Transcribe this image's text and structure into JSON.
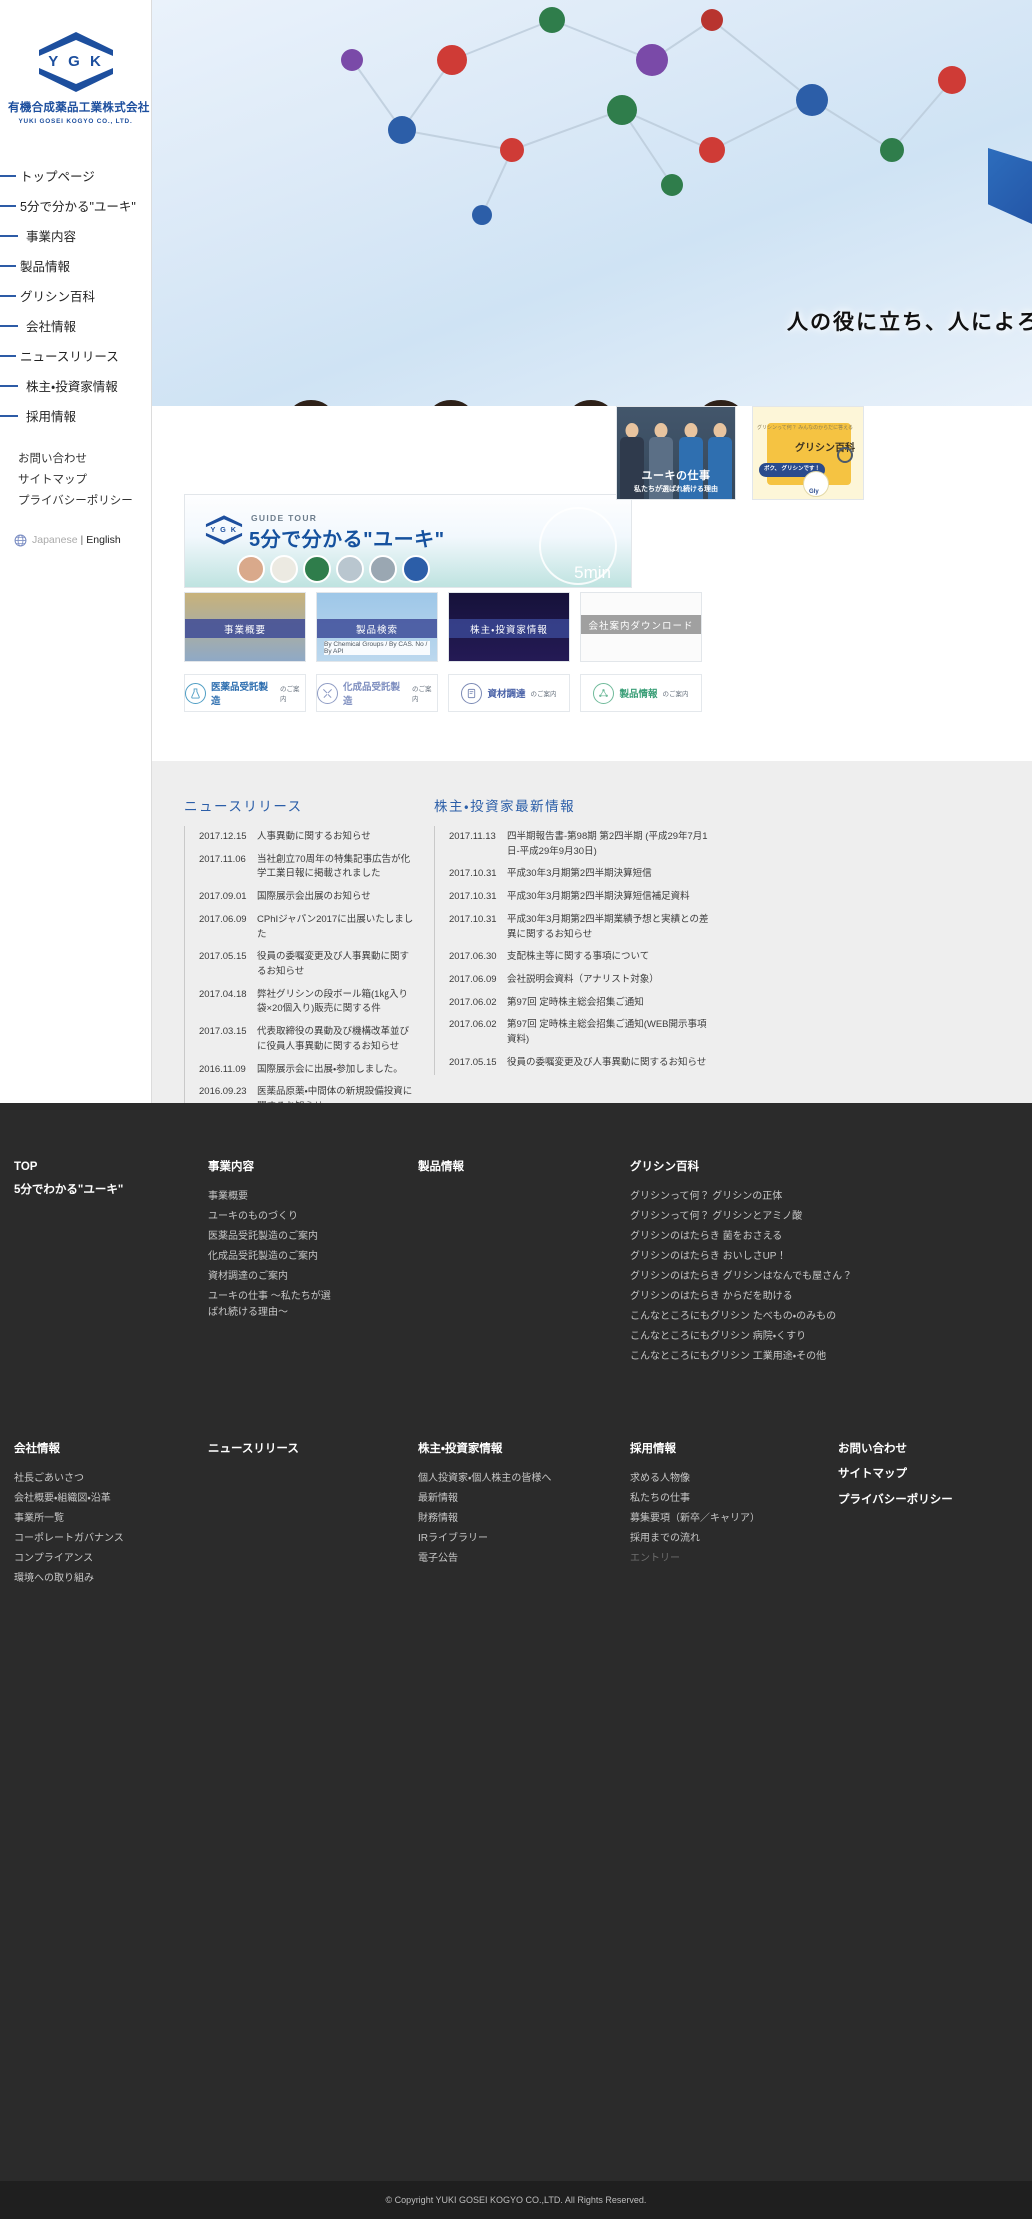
{
  "brand": {
    "logo_letters": "Y G K",
    "name_ja": "有機合成薬品工業株式会社",
    "name_en": "YUKI GOSEI KOGYO CO., LTD."
  },
  "sidebar": {
    "nav": [
      {
        "label": "トップページ"
      },
      {
        "label": "5分で分かる\"ユーキ\""
      },
      {
        "label": "事業内容"
      },
      {
        "label": "製品情報"
      },
      {
        "label": "グリシン百科"
      },
      {
        "label": "会社情報"
      },
      {
        "label": "ニュースリリース"
      },
      {
        "label": "株主・投資家情報"
      },
      {
        "label": "採用情報"
      }
    ],
    "sub": [
      {
        "label": "お問い合わせ"
      },
      {
        "label": "サイトマップ"
      },
      {
        "label": "プライバシーポリシー"
      }
    ],
    "lang": {
      "icon": "globe-icon",
      "japanese": "Japanese",
      "separator": "|",
      "english": "English"
    }
  },
  "hero": {
    "headline": "人の役に立ち、人によろ"
  },
  "banners": {
    "guide": {
      "kicker": "GUIDE TOUR",
      "title": "5分で分かる\"ユーキ\"",
      "timer": "5min",
      "logo_letters": "Y G K"
    },
    "work": {
      "title": "ユーキの仕事",
      "subtitle": "私たちが選ばれ続ける理由"
    },
    "glycine": {
      "kicker": "グリシンって何？\nみんなのからだに答える",
      "title": "グリシン百科",
      "bubble": "ボク、\nグリシンです！",
      "character": "Gly"
    },
    "tiles": [
      {
        "label": "事業概要",
        "sub": ""
      },
      {
        "label": "製品検索",
        "sub": "By Chemical Groups / By CAS. No / By API"
      },
      {
        "label": "株主・投資家情報",
        "sub": ""
      },
      {
        "label": "会社案内ダウンロード",
        "sub": ""
      }
    ],
    "links": [
      {
        "icon": "flask-icon",
        "title": "医薬品受託製造",
        "suffix": "のご案内"
      },
      {
        "icon": "tools-icon",
        "title": "化成品受託製造",
        "suffix": "のご案内"
      },
      {
        "icon": "clipboard-icon",
        "title": "資材調達",
        "suffix": "のご案内"
      },
      {
        "icon": "molecule-icon",
        "title": "製品情報",
        "suffix": "のご案内"
      }
    ]
  },
  "news": {
    "left_title": "ニュースリリース",
    "left_items": [
      {
        "date": "2017.12.15",
        "text": "人事異動に関するお知らせ"
      },
      {
        "date": "2017.11.06",
        "text": "当社創立70周年の特集記事広告が化学工業日報に掲載されました"
      },
      {
        "date": "2017.09.01",
        "text": "国際展示会出展のお知らせ"
      },
      {
        "date": "2017.06.09",
        "text": "CPhIジャパン2017に出展いたしました"
      },
      {
        "date": "2017.05.15",
        "text": "役員の委嘱変更及び人事異動に関するお知らせ"
      },
      {
        "date": "2017.04.18",
        "text": "弊社グリシンの段ボール箱(1㎏入り 袋×20個入り)販売に関する件"
      },
      {
        "date": "2017.03.15",
        "text": "代表取締役の異動及び機構改革並びに役員人事異動に関するお知らせ"
      },
      {
        "date": "2016.11.09",
        "text": "国際展示会に出展・参加しました。"
      },
      {
        "date": "2016.09.23",
        "text": "医薬品原薬・中間体の新規設備投資に関するお知らせ"
      }
    ],
    "right_title": "株主・投資家最新情報",
    "right_items": [
      {
        "date": "2017.11.13",
        "text": "四半期報告書-第98期 第2四半期 (平成29年7月1日-平成29年9月30日)"
      },
      {
        "date": "2017.10.31",
        "text": "平成30年3月期第2四半期決算短信"
      },
      {
        "date": "2017.10.31",
        "text": "平成30年3月期第2四半期決算短信補足資料"
      },
      {
        "date": "2017.10.31",
        "text": "平成30年3月期第2四半期業績予想と実績との差異に関するお知らせ"
      },
      {
        "date": "2017.06.30",
        "text": "支配株主等に関する事項について"
      },
      {
        "date": "2017.06.09",
        "text": "会社説明会資料（アナリスト対象）"
      },
      {
        "date": "2017.06.02",
        "text": "第97回 定時株主総会招集ご通知"
      },
      {
        "date": "2017.06.02",
        "text": "第97回 定時株主総会招集ご通知(WEB開示事項資料)"
      },
      {
        "date": "2017.05.15",
        "text": "役員の委嘱変更及び人事異動に関するお知らせ"
      }
    ]
  },
  "footer": {
    "col_top": {
      "title1": "TOP",
      "title2": "5分でわかる\"ユーキ\""
    },
    "col_business": {
      "title": "事業内容",
      "links": [
        "事業概要",
        "ユーキのものづくり",
        "医薬品受託製造のご案内",
        "化成品受託製造のご案内",
        "資材調達のご案内",
        "ユーキの仕事\n～私たちが選ばれ続ける理由～"
      ]
    },
    "col_products": {
      "title": "製品情報",
      "links": []
    },
    "col_glycine": {
      "title": "グリシン百科",
      "links": [
        "グリシンって何？ グリシンの正体",
        "グリシンって何？ グリシンとアミノ酸",
        "グリシンのはたらき 菌をおさえる",
        "グリシンのはたらき おいしさUP！",
        "グリシンのはたらき グリシンはなんでも屋さん？",
        "グリシンのはたらき からだを助ける",
        "こんなところにもグリシン たべもの・のみもの",
        "こんなところにもグリシン 病院・くすり",
        "こんなところにもグリシン 工業用途・その他"
      ]
    },
    "col_company": {
      "title": "会社情報",
      "links": [
        "社長ごあいさつ",
        "会社概要・組織図・沿革",
        "事業所一覧",
        "コーポレートガバナンス",
        "コンプライアンス",
        "環境への取り組み"
      ]
    },
    "col_news": {
      "title": "ニュースリリース",
      "links": []
    },
    "col_ir": {
      "title": "株主・投資家情報",
      "links": [
        "個人投資家・個人株主の皆様へ",
        "最新情報",
        "財務情報",
        "IRライブラリー",
        "電子公告"
      ]
    },
    "col_recruit": {
      "title": "採用情報",
      "links": [
        "求める人物像",
        "私たちの仕事",
        "募集要項（新卒／キャリア）",
        "採用までの流れ"
      ],
      "dim_link": "エントリー"
    },
    "col_contact": {
      "title": "お問い合わせ",
      "links": [
        "サイトマップ",
        "プライバシーポリシー"
      ]
    },
    "copyright": "© Copyright YUKI GOSEI KOGYO CO.,LTD. All Rights Reserved."
  },
  "colors": {
    "brand_blue": "#1d4f9e",
    "accent_blue": "#2b5ea8",
    "footer_bg": "#2b2b2b",
    "news_bg": "#eeeeee"
  }
}
